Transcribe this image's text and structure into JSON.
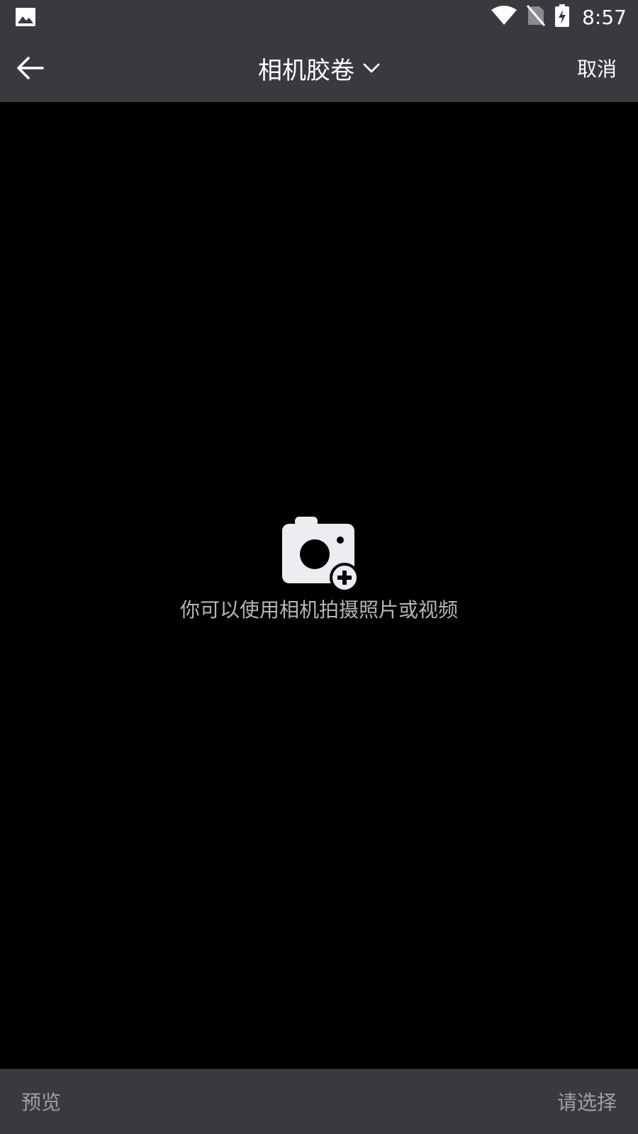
{
  "status_bar": {
    "time": "8:57",
    "icons": [
      "image-notification-icon",
      "wifi-icon",
      "no-sim-icon",
      "battery-charging-icon"
    ]
  },
  "app_bar": {
    "title": "相机胶卷",
    "cancel_label": "取消",
    "icons": [
      "back-arrow-icon",
      "chevron-down-icon"
    ]
  },
  "empty_state": {
    "icon": "camera-add-icon",
    "message": "你可以使用相机拍摄照片或视频"
  },
  "bottom_bar": {
    "preview_label": "预览",
    "select_label": "请选择"
  },
  "colors": {
    "bar_background": "#393a3f",
    "content_background": "#000000",
    "primary_text": "#ffffff",
    "secondary_text": "#b3b6bc",
    "disabled_text": "#9ea0a4"
  }
}
